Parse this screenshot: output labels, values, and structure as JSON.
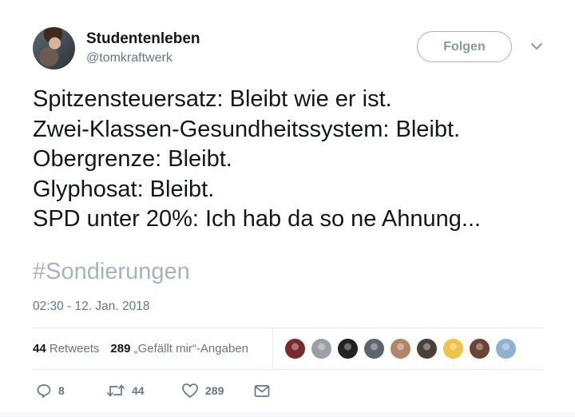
{
  "user": {
    "name": "Studentenleben",
    "handle": "@tomkraftwerk"
  },
  "follow_label": "Folgen",
  "tweet_lines": [
    "Spitzensteuersatz: Bleibt wie er ist.",
    "Zwei-Klassen-Gesundheitssystem: Bleibt.",
    "Obergrenze: Bleibt.",
    "Glyphosat: Bleibt.",
    "SPD unter 20%: Ich hab da so ne Ahnung..."
  ],
  "hashtag": "#Sondierungen",
  "timestamp": "02:30 - 12. Jan. 2018",
  "stats": {
    "retweets_count": "44",
    "retweets_label": "Retweets",
    "likes_count": "289",
    "likes_label": "„Gefällt mir“-Angaben"
  },
  "liker_avatars": [
    {
      "icon": "liker-avatar-1",
      "color": "#7a2a2a"
    },
    {
      "icon": "liker-avatar-2",
      "color": "#9aa0a4"
    },
    {
      "icon": "liker-avatar-3",
      "color": "#1f2326"
    },
    {
      "icon": "liker-avatar-4",
      "color": "#5e646b"
    },
    {
      "icon": "liker-avatar-5",
      "color": "#b28569"
    },
    {
      "icon": "liker-avatar-6",
      "color": "#4a4038"
    },
    {
      "icon": "liker-avatar-7",
      "color": "#f0c24a"
    },
    {
      "icon": "liker-avatar-8",
      "color": "#6b4434"
    },
    {
      "icon": "liker-avatar-9",
      "color": "#8fb0cf"
    }
  ],
  "actions": {
    "reply_count": "8",
    "retweet_count": "44",
    "like_count": "289"
  },
  "colors": {
    "muted": "#657786",
    "hashtag": "#a4b3c1",
    "divider": "#e6ecf0"
  }
}
